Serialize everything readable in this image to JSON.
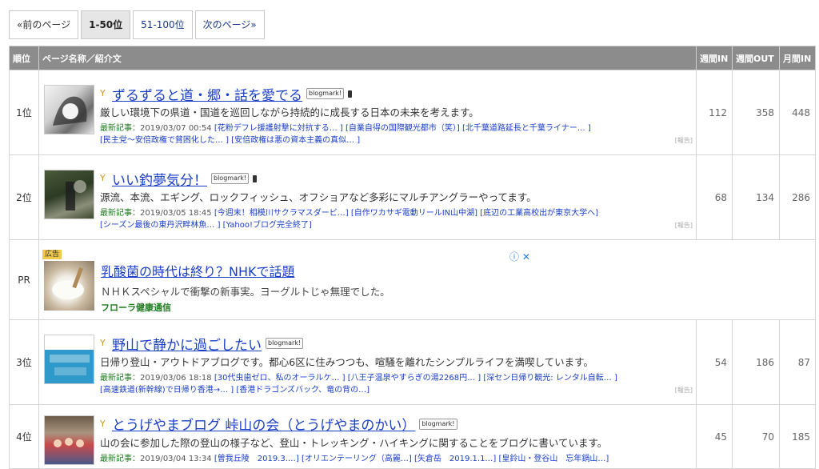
{
  "pager": {
    "prev": "«前のページ",
    "current": "1-50位",
    "next_range": "51-100位",
    "next": "次のページ»"
  },
  "columns": {
    "rank": "順位",
    "page": "ページ名称／紹介文",
    "week_in": "週間IN",
    "week_out": "週間OUT",
    "month_in": "月間IN"
  },
  "labels": {
    "latest": "最新記事：",
    "blogmark": "blogmark!",
    "report": "[報告]"
  },
  "rows": [
    {
      "rank": "1位",
      "title": "ずるずると道・郷・話を愛でる",
      "desc": "厳しい環境下の県道・国道を巡回しながら持続的に成長する日本の未来を考えます。",
      "latest_date": "2019/03/07 00:54",
      "articles": [
        "[花粉デフレ援護射撃に対抗する… ]",
        "[自業自得の国際観光都市（笑）]",
        "[北千葉道路延長と千葉ライナー… ]",
        "[民主党〜安倍政権で貧困化した… ]",
        "[安倍政権は悪の資本主義の真似… ]"
      ],
      "week_in": "112",
      "week_out": "358",
      "month_in": "448"
    },
    {
      "rank": "2位",
      "title": "いい釣夢気分！",
      "desc": "源流、本流、エギング、ロックフィッシュ、オフショアなど多彩にマルチアングラーやってます。",
      "latest_date": "2019/03/05 18:45",
      "articles": [
        "[今週末！相模川サクラマスダービ…]",
        "[自作ワカサギ電動リールIN山中湖]",
        "[底辺の工業高校出が東京大学へ]",
        "[シーズン最後の東丹沢畔林魚… ]",
        "[Yahoo!ブログ完全終了]"
      ],
      "week_in": "68",
      "week_out": "134",
      "month_in": "286"
    },
    {
      "rank": "3位",
      "title": "野山で静かに過ごしたい",
      "desc": "日帰り登山・アウトドアブログです。都心6区に住みつつも、喧騒を離れたシンプルライフを満喫しています。",
      "latest_date": "2019/03/06 18:18",
      "articles": [
        "[30代虫歯ゼロ、私のオーラルケ… ]",
        "[八王子温泉やすらぎの湯2268円… ]",
        "[深セン日帰り観光: レンタル自転… ]",
        "[高速鉄道(新幹線)で日帰り香港→… ]",
        "[香港ドラゴンズバック、竜の背の…]"
      ],
      "week_in": "54",
      "week_out": "186",
      "month_in": "87"
    },
    {
      "rank": "4位",
      "title": "とうげやまブログ 峠山の会（とうげやまのかい）",
      "desc": "山の会に参加した際の登山の様子など、登山・トレッキング・ハイキングに関することをブログに書いています。",
      "latest_date": "2019/03/04 13:34",
      "articles": [
        "[曽我丘陵　2019.3.…]",
        "[オリエンテーリング（高麗…]",
        "[矢倉岳　2019.1.1…]",
        "[皇鈴山・登谷山　忘年鍋山…]"
      ],
      "week_in": "45",
      "week_out": "70",
      "month_in": "185"
    }
  ],
  "pr": {
    "rank": "PR",
    "badge": "広告",
    "info": "ⓘ ✕",
    "title": "乳酸菌の時代は終り？NHKで話題",
    "desc": "ＮＨＫスペシャルで衝撃の新事実。ヨーグルトじゃ無理でした。",
    "brand": "フローラ健康通信"
  }
}
